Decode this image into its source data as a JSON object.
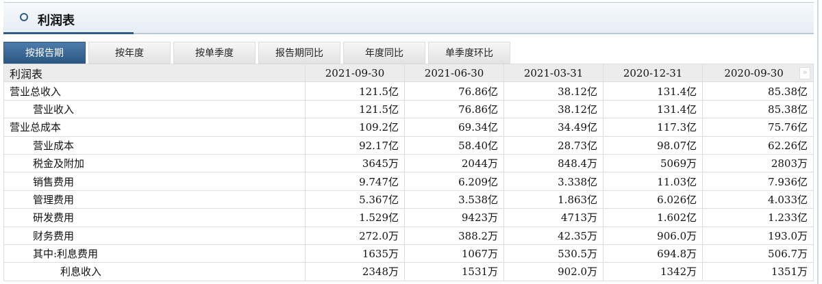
{
  "header": {
    "title": "利润表"
  },
  "tabs": [
    "按报告期",
    "按年度",
    "按单季度",
    "报告期同比",
    "年度同比",
    "单季度环比"
  ],
  "table": {
    "title": "利润表",
    "more": "»",
    "columns": [
      "2021-09-30",
      "2021-06-30",
      "2021-03-31",
      "2020-12-31",
      "2020-09-30"
    ],
    "rows": [
      {
        "label": "营业总收入",
        "level": 1,
        "values": [
          "121.5亿",
          "76.86亿",
          "38.12亿",
          "131.4亿",
          "85.38亿"
        ]
      },
      {
        "label": "营业收入",
        "level": 2,
        "values": [
          "121.5亿",
          "76.86亿",
          "38.12亿",
          "131.4亿",
          "85.38亿"
        ]
      },
      {
        "label": "营业总成本",
        "level": 1,
        "values": [
          "109.2亿",
          "69.34亿",
          "34.49亿",
          "117.3亿",
          "75.76亿"
        ]
      },
      {
        "label": "营业成本",
        "level": 2,
        "values": [
          "92.17亿",
          "58.40亿",
          "28.73亿",
          "98.07亿",
          "62.26亿"
        ]
      },
      {
        "label": "税金及附加",
        "level": 2,
        "values": [
          "3645万",
          "2044万",
          "848.4万",
          "5069万",
          "2803万"
        ]
      },
      {
        "label": "销售费用",
        "level": 2,
        "values": [
          "9.747亿",
          "6.209亿",
          "3.338亿",
          "11.03亿",
          "7.936亿"
        ]
      },
      {
        "label": "管理费用",
        "level": 2,
        "values": [
          "5.367亿",
          "3.538亿",
          "1.863亿",
          "6.026亿",
          "4.033亿"
        ]
      },
      {
        "label": "研发费用",
        "level": 2,
        "values": [
          "1.529亿",
          "9423万",
          "4713万",
          "1.602亿",
          "1.233亿"
        ]
      },
      {
        "label": "财务费用",
        "level": 2,
        "values": [
          "272.0万",
          "388.2万",
          "42.35万",
          "906.0万",
          "193.0万"
        ]
      },
      {
        "label": "其中:利息费用",
        "level": 2,
        "values": [
          "1635万",
          "1067万",
          "530.5万",
          "694.8万",
          "506.7万"
        ]
      },
      {
        "label": "利息收入",
        "level": 3,
        "values": [
          "2348万",
          "1531万",
          "902.0万",
          "1342万",
          "1351万"
        ]
      }
    ]
  }
}
